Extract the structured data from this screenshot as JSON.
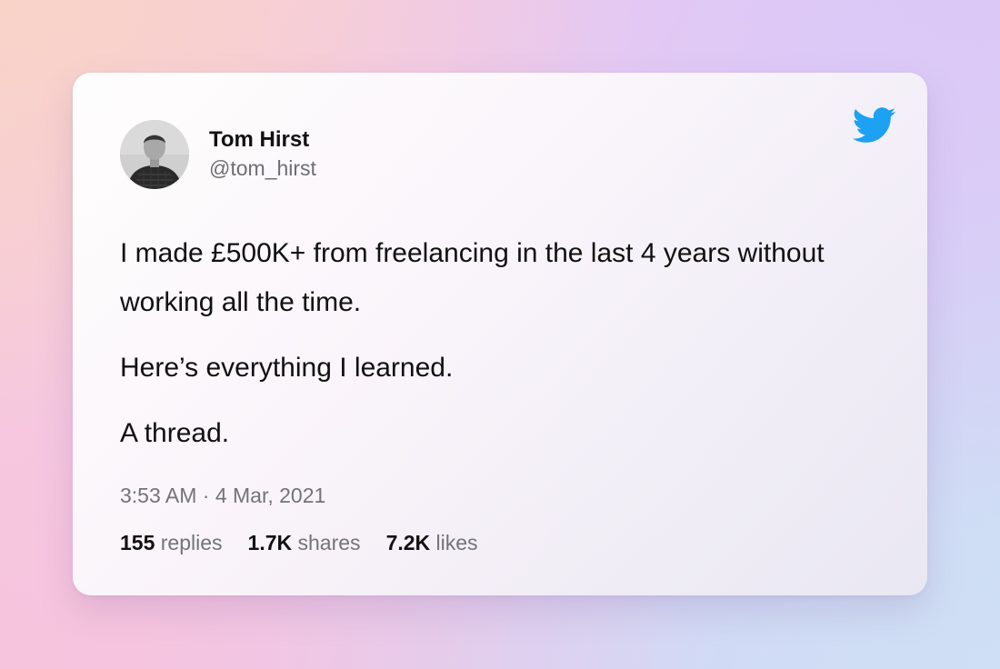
{
  "tweet": {
    "author": {
      "name": "Tom Hirst",
      "handle": "@tom_hirst"
    },
    "platform_icon": "twitter-bird-icon",
    "paragraphs": [
      "I made £500K+ from freelancing in the last 4 years without working all the time.",
      "Here’s everything I learned.",
      "A thread."
    ],
    "timestamp": "3:53 AM · 4 Mar, 2021",
    "stats": {
      "replies": {
        "value": "155",
        "label": "replies"
      },
      "shares": {
        "value": "1.7K",
        "label": "shares"
      },
      "likes": {
        "value": "7.2K",
        "label": "likes"
      }
    }
  },
  "colors": {
    "twitter_blue": "#1DA1F2",
    "text_primary": "#111111",
    "text_secondary": "#737378"
  }
}
